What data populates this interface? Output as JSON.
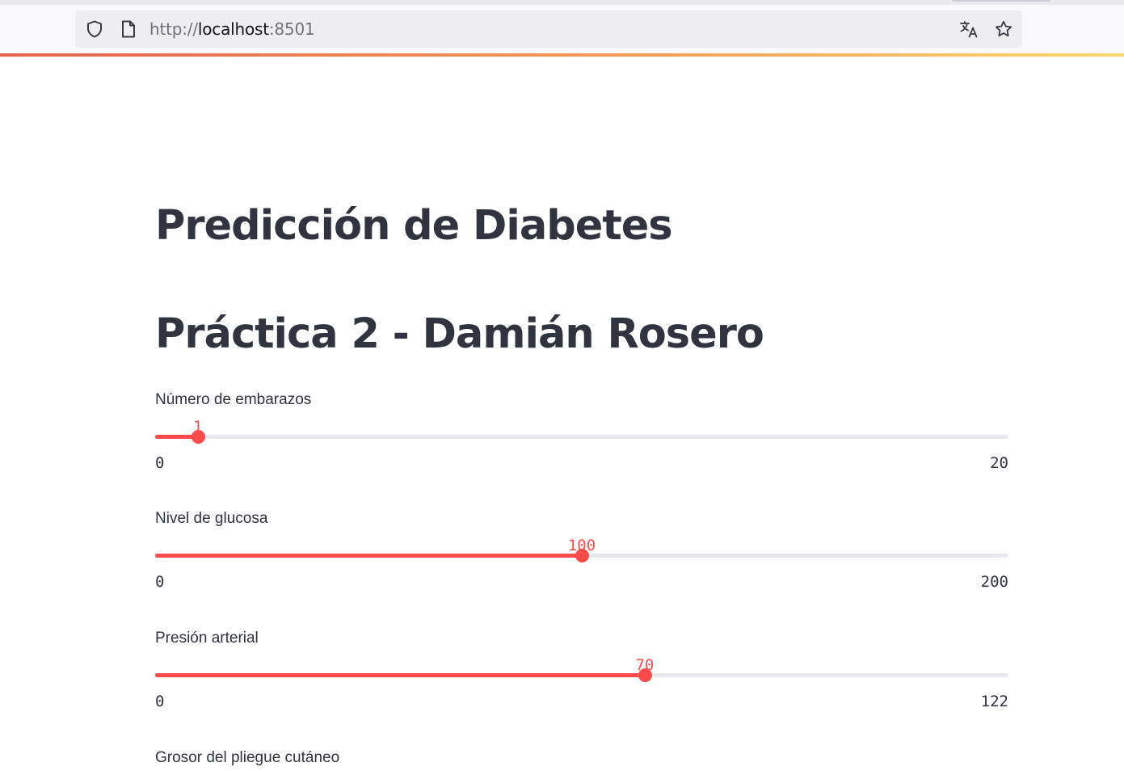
{
  "browser": {
    "url_scheme": "http://",
    "url_host": "localhost",
    "url_port": ":8501",
    "icons": [
      "shield-icon",
      "page-icon",
      "translate-icon",
      "star-icon"
    ]
  },
  "app": {
    "title": "Predicción de Diabetes",
    "subtitle": "Práctica 2 - Damián Rosero",
    "accent_color": "#ff4b4b",
    "sliders": [
      {
        "label": "Número de embarazos",
        "value": 1,
        "min": 0,
        "max": 20
      },
      {
        "label": "Nivel de glucosa",
        "value": 100,
        "min": 0,
        "max": 200
      },
      {
        "label": "Presión arterial",
        "value": 70,
        "min": 0,
        "max": 122
      },
      {
        "label": "Grosor del pliegue cutáneo"
      }
    ]
  }
}
